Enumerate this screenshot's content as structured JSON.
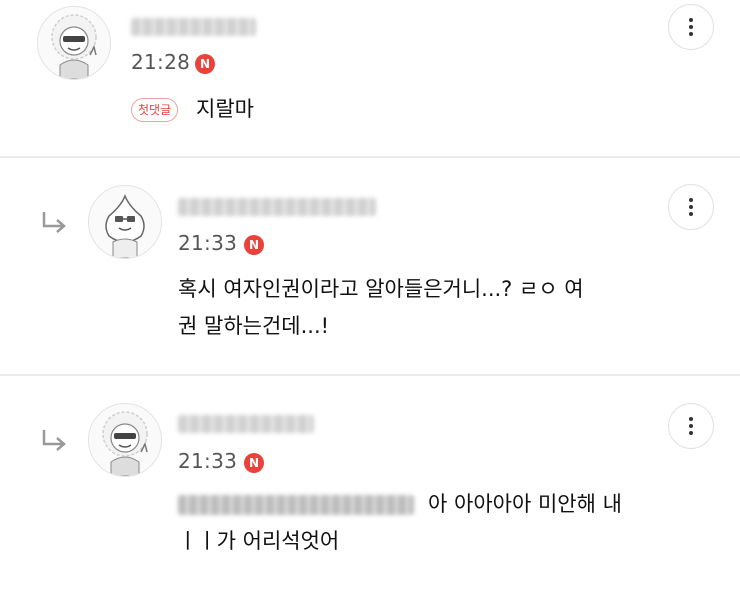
{
  "comments": [
    {
      "nickname": "",
      "time": "21:28",
      "new_badge": "N",
      "first_badge": "첫댓글",
      "text": "지랄마"
    },
    {
      "nickname": "",
      "time": "21:33",
      "new_badge": "N",
      "text_line1": "혹시 여자인권이라고 알아들은거니...? ㄹㅇ 여",
      "text_line2": "권 말하는건데...!"
    },
    {
      "nickname": "",
      "time": "21:33",
      "new_badge": "N",
      "mention": "",
      "text_line1": "아 아아아아 미안해 내",
      "text_line2": "ㅣㅣ가 어리석엇어"
    }
  ],
  "icons": {
    "more": "more-vertical-icon",
    "reply": "reply-arrow-icon",
    "new": "new-badge-icon"
  },
  "colors": {
    "new_badge": "#e8423a",
    "divider": "#ececec"
  }
}
